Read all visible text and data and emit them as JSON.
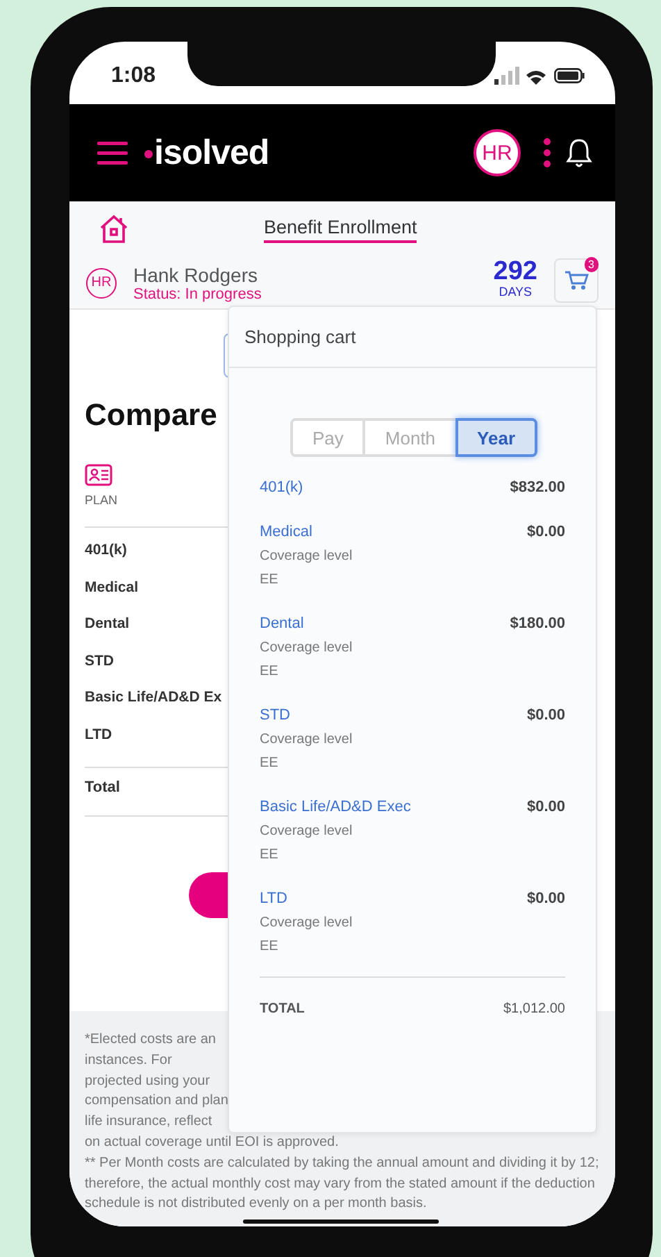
{
  "status_bar": {
    "time": "1:08"
  },
  "header": {
    "logo": "isolved",
    "avatar": "HR"
  },
  "nav": {
    "title": "Benefit Enrollment"
  },
  "user": {
    "initials": "HR",
    "name": "Hank Rodgers",
    "status": "Status: In progress",
    "days": "292",
    "days_label": "DAYS",
    "cart_count": "3"
  },
  "page": {
    "heading": "Compare",
    "plan_label": "PLAN",
    "rows": [
      "401(k)",
      "Medical",
      "Dental",
      "STD",
      "Basic Life/AD&D Ex",
      "LTD"
    ],
    "total_label": "Total"
  },
  "footnote": {
    "lines": [
      "*Elected costs are an",
      "instances. For",
      "projected using your",
      "compensation and plan",
      "life insurance, reflect",
      "on actual coverage until EOI is approved.",
      "** Per Month costs are calculated by taking the annual amount and dividing it by 12;",
      "therefore, the actual monthly cost may vary from the stated amount if the deduction",
      "schedule is not distributed evenly on a per month basis."
    ]
  },
  "cart": {
    "title": "Shopping cart",
    "periods": [
      {
        "label": "Pay",
        "selected": false
      },
      {
        "label": "Month",
        "selected": false
      },
      {
        "label": "Year",
        "selected": true
      }
    ],
    "items": [
      {
        "name": "401(k)",
        "amount": "$832.00"
      },
      {
        "name": "Medical",
        "amount": "$0.00",
        "coverage_label": "Coverage level",
        "coverage": "EE"
      },
      {
        "name": "Dental",
        "amount": "$180.00",
        "coverage_label": "Coverage level",
        "coverage": "EE"
      },
      {
        "name": "STD",
        "amount": "$0.00",
        "coverage_label": "Coverage level",
        "coverage": "EE"
      },
      {
        "name": "Basic Life/AD&D Exec",
        "amount": "$0.00",
        "coverage_label": "Coverage level",
        "coverage": "EE"
      },
      {
        "name": "LTD",
        "amount": "$0.00",
        "coverage_label": "Coverage level",
        "coverage": "EE"
      }
    ],
    "total_label": "TOTAL",
    "total": "$1,012.00"
  }
}
